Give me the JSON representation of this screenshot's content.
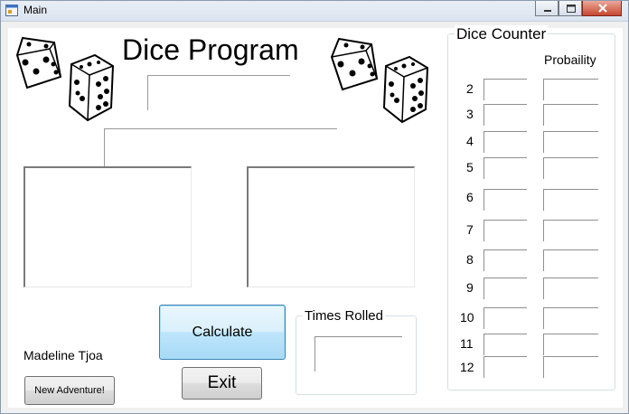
{
  "window": {
    "title": "Main"
  },
  "form": {
    "heading": "Dice Program",
    "author": "Madeline Tjoa",
    "new_adventure_label": "New Adventure!",
    "calculate_label": "Calculate",
    "exit_label": "Exit",
    "times_rolled_title": "Times Rolled"
  },
  "dice_counter": {
    "title": "Dice Counter",
    "probability_header": "Probaility",
    "rows": [
      "2",
      "3",
      "4",
      "5",
      "6",
      "7",
      "8",
      "9",
      "10",
      "11",
      "12"
    ]
  }
}
